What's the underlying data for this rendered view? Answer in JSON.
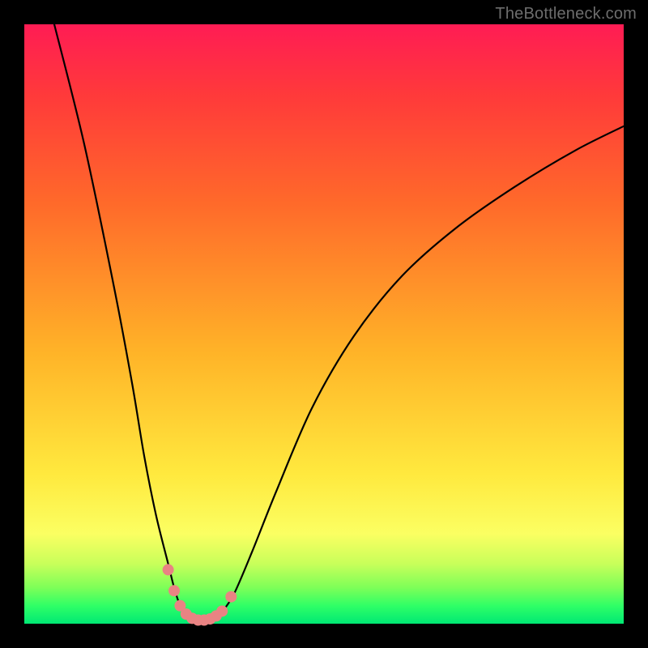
{
  "watermark": "TheBottleneck.com",
  "chart_data": {
    "type": "line",
    "title": "",
    "xlabel": "",
    "ylabel": "",
    "xlim": [
      0,
      100
    ],
    "ylim": [
      0,
      100
    ],
    "grid": false,
    "series": [
      {
        "name": "curve",
        "x": [
          5,
          10,
          15,
          18,
          20,
          22,
          24,
          25,
          26,
          27,
          28,
          29,
          30,
          31,
          32,
          33,
          35,
          38,
          42,
          48,
          55,
          63,
          72,
          82,
          92,
          100
        ],
        "y": [
          100,
          80,
          56,
          40,
          28,
          18,
          10,
          6,
          3,
          1.5,
          0.8,
          0.5,
          0.5,
          0.7,
          1.2,
          2,
          5,
          12,
          22,
          36,
          48,
          58,
          66,
          73,
          79,
          83
        ]
      }
    ],
    "markers": [
      {
        "x": 24.0,
        "y": 9.0
      },
      {
        "x": 25.0,
        "y": 5.5
      },
      {
        "x": 26.0,
        "y": 3.0
      },
      {
        "x": 27.0,
        "y": 1.6
      },
      {
        "x": 28.0,
        "y": 0.9
      },
      {
        "x": 29.0,
        "y": 0.6
      },
      {
        "x": 30.0,
        "y": 0.6
      },
      {
        "x": 31.0,
        "y": 0.8
      },
      {
        "x": 32.0,
        "y": 1.3
      },
      {
        "x": 33.0,
        "y": 2.1
      },
      {
        "x": 34.5,
        "y": 4.5
      }
    ]
  }
}
